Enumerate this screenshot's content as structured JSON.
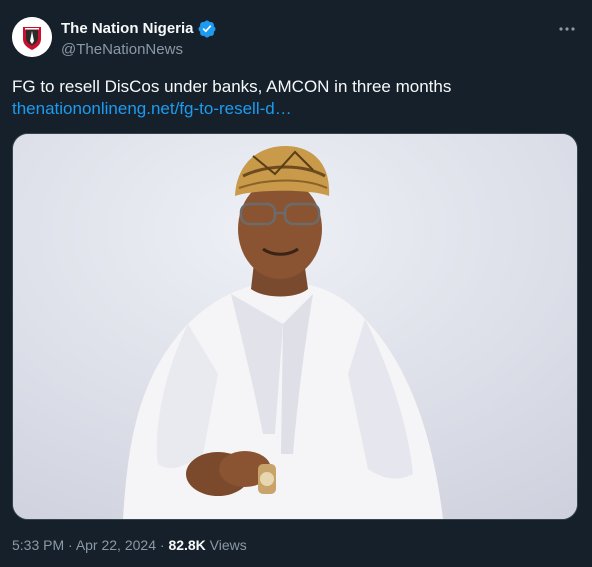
{
  "author": {
    "display_name": "The Nation Nigeria",
    "handle": "@TheNationNews",
    "verified": true,
    "avatar_icon": "the-nation-logo",
    "verified_icon": "verified-badge-icon",
    "verified_color": "#1d9bf0"
  },
  "tweet": {
    "text": "FG to resell DisCos under banks, AMCON in three months",
    "link": "thenationonlineng.net/fg-to-resell-d…"
  },
  "media": {
    "kind": "photo",
    "background_color": "#dcdde5"
  },
  "meta": {
    "time": "5:33 PM",
    "separator": " · ",
    "date": "Apr 22, 2024",
    "views_count": "82.8K",
    "views_label": " Views"
  },
  "icons": {
    "more": "more-options-icon"
  },
  "colors": {
    "background": "#15202b",
    "text_primary": "#f7f9f9",
    "text_secondary": "#8b98a5",
    "link": "#1d9bf0",
    "border": "#38444d"
  }
}
